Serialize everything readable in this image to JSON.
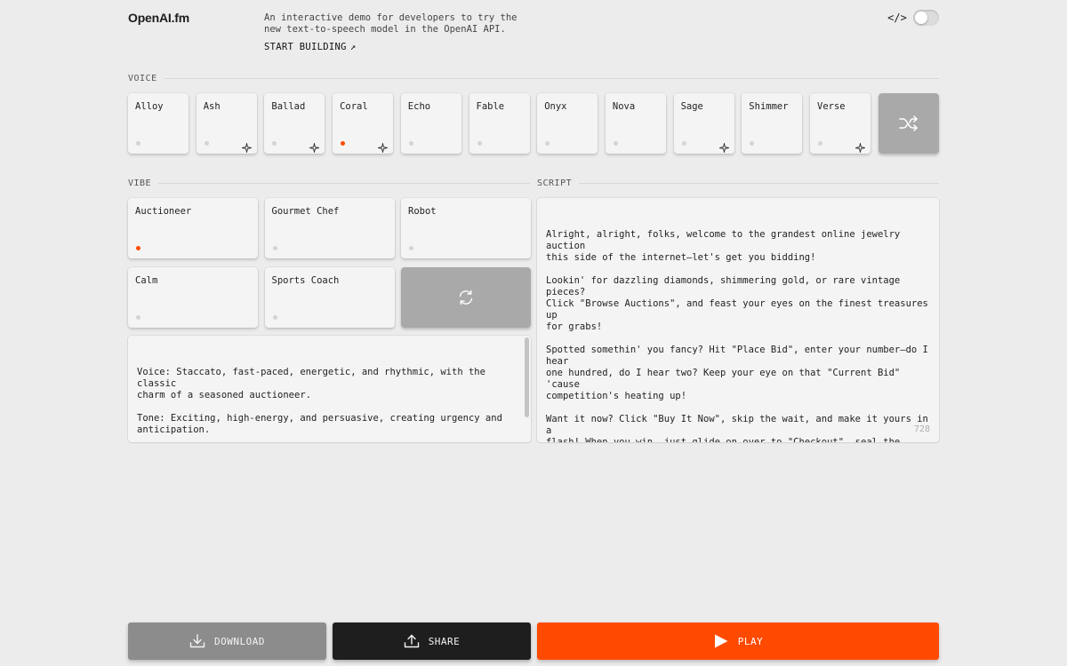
{
  "header": {
    "logo": "OpenAI.fm",
    "tagline": "An interactive demo for developers to try the\nnew text-to-speech model in the OpenAI API.",
    "start_building": "START BUILDING",
    "start_arrow": "↗",
    "code_icon_glyph": "</>",
    "toggle_on": false
  },
  "voice": {
    "section_label": "VOICE",
    "selected": "Coral",
    "items": [
      {
        "label": "Alloy",
        "sparkle": false,
        "active": false
      },
      {
        "label": "Ash",
        "sparkle": true,
        "active": false
      },
      {
        "label": "Ballad",
        "sparkle": true,
        "active": false
      },
      {
        "label": "Coral",
        "sparkle": true,
        "active": true
      },
      {
        "label": "Echo",
        "sparkle": false,
        "active": false
      },
      {
        "label": "Fable",
        "sparkle": false,
        "active": false
      },
      {
        "label": "Onyx",
        "sparkle": false,
        "active": false
      },
      {
        "label": "Nova",
        "sparkle": false,
        "active": false
      },
      {
        "label": "Sage",
        "sparkle": true,
        "active": false
      },
      {
        "label": "Shimmer",
        "sparkle": false,
        "active": false
      },
      {
        "label": "Verse",
        "sparkle": true,
        "active": false
      }
    ]
  },
  "vibe": {
    "section_label": "VIBE",
    "selected": "Auctioneer",
    "items": [
      {
        "label": "Auctioneer",
        "active": true
      },
      {
        "label": "Gourmet Chef",
        "active": false
      },
      {
        "label": "Robot",
        "active": false
      },
      {
        "label": "Calm",
        "active": false
      },
      {
        "label": "Sports Coach",
        "active": false
      }
    ],
    "description": "Voice: Staccato, fast-paced, energetic, and rhythmic, with the classic\ncharm of a seasoned auctioneer.\n\nTone: Exciting, high-energy, and persuasive, creating urgency and\nanticipation.\n\nDelivery: Rapid-fire yet clear, with dynamic inflections to keep\nengagement high and momentum strong."
  },
  "script": {
    "section_label": "SCRIPT",
    "text": "Alright, alright, folks, welcome to the grandest online jewelry auction\nthis side of the internet—let's get you bidding!\n\nLookin' for dazzling diamonds, shimmering gold, or rare vintage pieces?\nClick \"Browse Auctions\", and feast your eyes on the finest treasures up\nfor grabs!\n\nSpotted somethin' you fancy? Hit \"Place Bid\", enter your number—do I hear\none hundred, do I hear two? Keep your eye on that \"Current Bid\" 'cause\ncompetition's heating up!\n\nWant it now? Click \"Buy It Now\", skip the wait, and make it yours in a\nflash! When you win, just glide on over to \"Checkout\", seal the deal, and\nthat beauty's on its way!\n\nDon't blink, don't hesitate—these gems move fast! Bid bold, bid smart,\nand may fortune shine on you! SOLD!",
    "char_count": "728"
  },
  "actions": {
    "download": "DOWNLOAD",
    "share": "SHARE",
    "play": "PLAY"
  },
  "colors": {
    "accent": "#ff4a00",
    "background": "#ececec",
    "card": "#f4f4f4",
    "shuffle_card": "#a9a9a9"
  }
}
